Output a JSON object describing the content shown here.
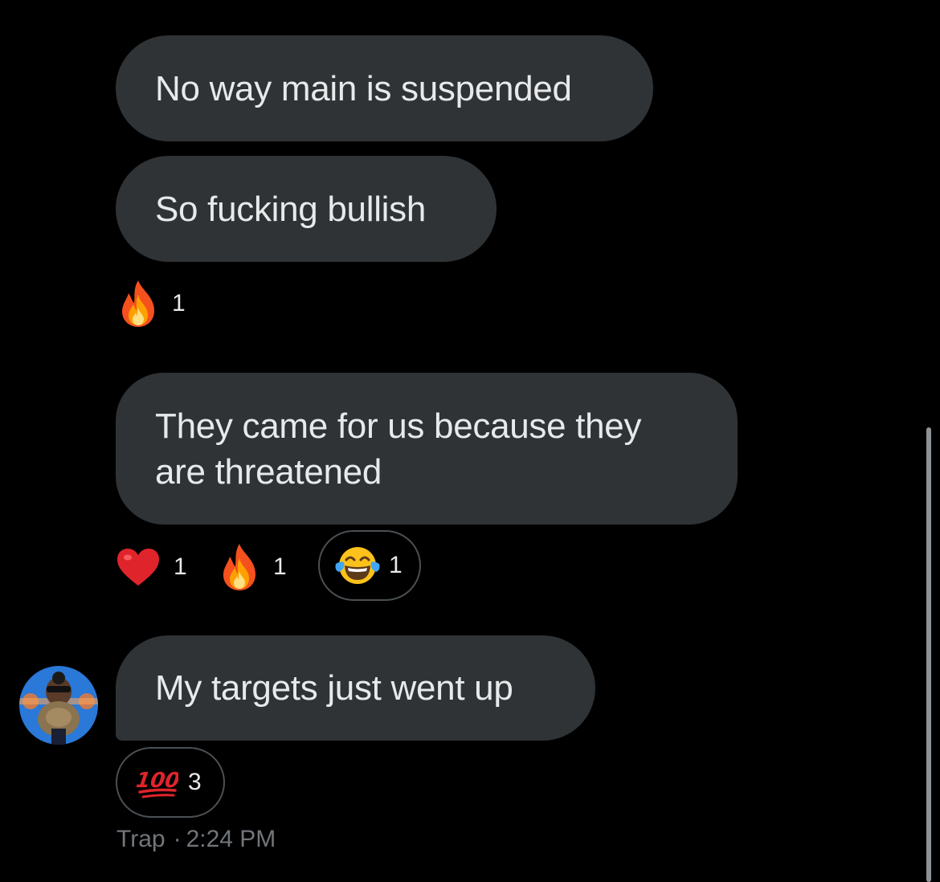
{
  "messages": [
    {
      "text": "No way main is suspended"
    },
    {
      "text": "So fucking bullish"
    },
    {
      "text": "They came for us because they are threatened"
    },
    {
      "text": "My targets just went up"
    }
  ],
  "reactions": {
    "msg2": [
      {
        "icon": "fire-icon",
        "count": "1"
      }
    ],
    "msg3": [
      {
        "icon": "red-heart-icon",
        "count": "1"
      },
      {
        "icon": "fire-icon",
        "count": "1"
      },
      {
        "icon": "face-with-tears-of-joy-icon",
        "count": "1"
      }
    ],
    "msg4": [
      {
        "icon": "hundred-points-icon",
        "count": "3"
      }
    ]
  },
  "footer": {
    "sender": "Trap",
    "separator": "·",
    "time": "2:24 PM"
  },
  "colors": {
    "background": "#000000",
    "bubble": "#2f3336",
    "text": "#e7e9ea",
    "meta": "#71767b"
  }
}
